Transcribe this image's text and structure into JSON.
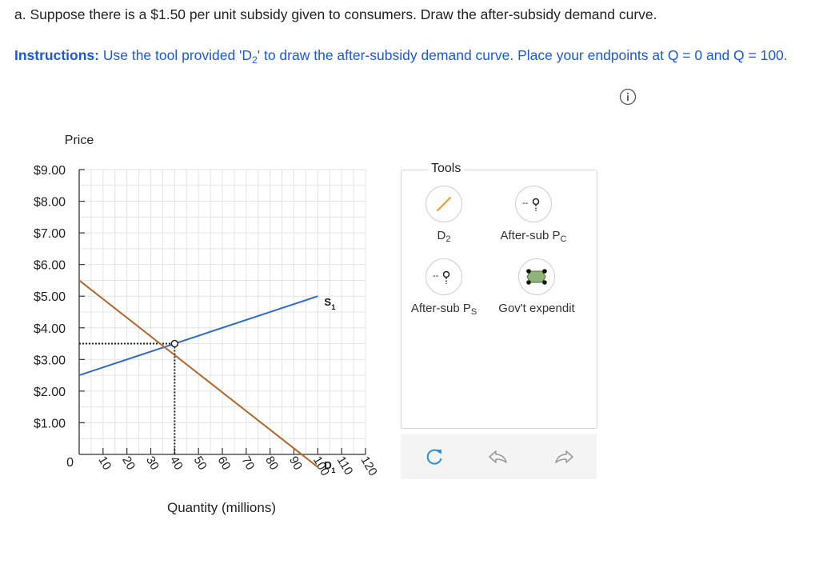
{
  "question": "a. Suppose there is a $1.50 per unit subsidy given to consumers. Draw the after-subsidy demand curve.",
  "instructions": {
    "lead": "Instructions:",
    "text_before_sub": " Use the tool provided 'D",
    "sub": "2",
    "text_after_sub": "' to draw the after-subsidy demand curve. Place your endpoints at Q = 0 and Q = 100."
  },
  "info_icon": "info-circle-icon",
  "tools": {
    "title": "Tools",
    "items": [
      {
        "name": "tool-d2",
        "label": "D",
        "sub": "2",
        "icon": "line-icon"
      },
      {
        "name": "tool-after-sub-pc",
        "label": "After-sub P",
        "sub": "C",
        "icon": "point-icon"
      },
      {
        "name": "tool-after-sub-ps",
        "label": "After-sub P",
        "sub": "S",
        "icon": "point-icon"
      },
      {
        "name": "tool-govt-expenditure",
        "label": "Gov't expendit",
        "sub": "",
        "icon": "polygon-icon"
      }
    ],
    "actions": [
      {
        "name": "reset-icon"
      },
      {
        "name": "undo-icon"
      },
      {
        "name": "redo-icon"
      }
    ]
  },
  "chart_data": {
    "type": "line",
    "ylabel": "Price",
    "xlabel": "Quantity (millions)",
    "x_range": [
      0,
      120
    ],
    "y_range": [
      0,
      9
    ],
    "x_ticks": [
      10,
      20,
      30,
      40,
      50,
      60,
      70,
      80,
      90,
      100,
      110,
      120
    ],
    "y_ticks": [
      {
        "value": 0,
        "label": "0"
      },
      {
        "value": 1,
        "label": "$1.00"
      },
      {
        "value": 2,
        "label": "$2.00"
      },
      {
        "value": 3,
        "label": "$3.00"
      },
      {
        "value": 4,
        "label": "$4.00"
      },
      {
        "value": 5,
        "label": "$5.00"
      },
      {
        "value": 6,
        "label": "$6.00"
      },
      {
        "value": 7,
        "label": "$7.00"
      },
      {
        "value": 8,
        "label": "$8.00"
      },
      {
        "value": 9,
        "label": "$9.00"
      }
    ],
    "grid": true,
    "series": [
      {
        "name": "S",
        "sub": "1",
        "color": "#2f6bc4",
        "points": [
          [
            0,
            2.5
          ],
          [
            100,
            5.0
          ]
        ]
      },
      {
        "name": "D",
        "sub": "1",
        "color": "#b5642a",
        "points": [
          [
            0,
            5.5
          ],
          [
            100,
            -0.4
          ]
        ]
      }
    ],
    "equilibrium": {
      "x": 40,
      "y": 3.5
    },
    "colors": {
      "grid": "#e4e4e4",
      "axis": "#333333",
      "dotted": "#222222"
    }
  }
}
